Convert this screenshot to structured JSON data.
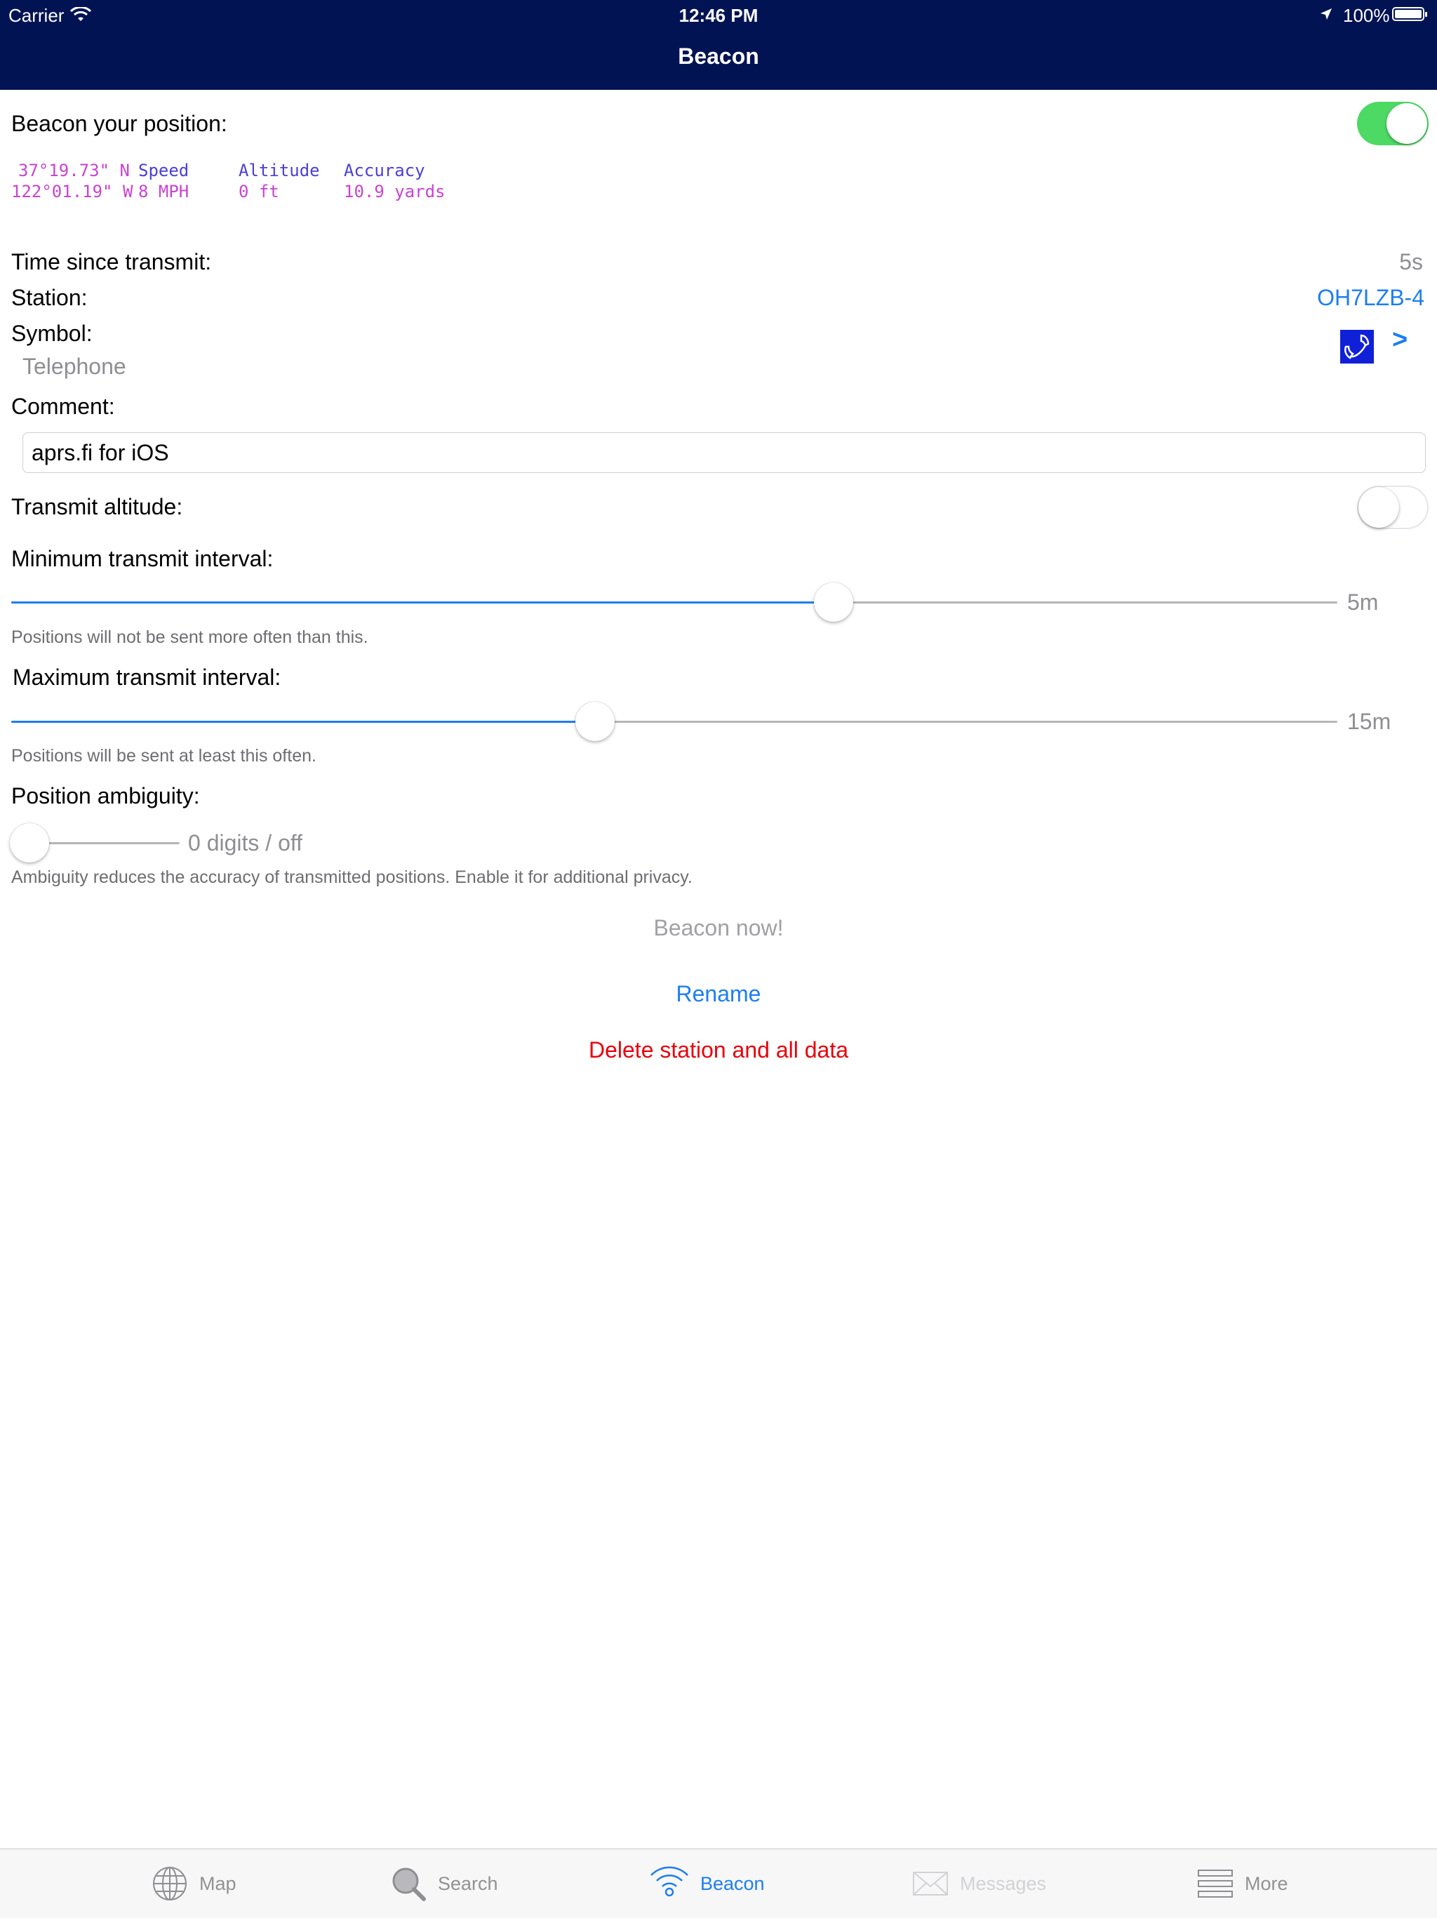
{
  "status_bar": {
    "carrier": "Carrier",
    "time": "12:46 PM",
    "battery": "100%"
  },
  "nav": {
    "title": "Beacon"
  },
  "beacon": {
    "label": "Beacon your position:",
    "enabled": true,
    "lat": "37°19.73\" N",
    "lon": "122°01.19\" W",
    "speed_label": "Speed",
    "speed_value": "8 MPH",
    "altitude_label": "Altitude",
    "altitude_value": "0 ft",
    "accuracy_label": "Accuracy",
    "accuracy_value": "10.9 yards"
  },
  "transmit": {
    "label": "Time since transmit:",
    "value": "5s"
  },
  "station": {
    "label": "Station:",
    "value": "OH7LZB-4"
  },
  "symbol": {
    "label": "Symbol:",
    "name": "Telephone",
    "icon": "telephone-icon",
    "chevron": ">"
  },
  "comment": {
    "label": "Comment:",
    "value": "aprs.fi for iOS"
  },
  "altitude_toggle": {
    "label": "Transmit altitude:",
    "enabled": false
  },
  "min_interval": {
    "label": "Minimum transmit interval:",
    "value": "5m",
    "level": 0.62,
    "footnote": "Positions will not be sent more often than this."
  },
  "max_interval": {
    "label": "Maximum transmit interval:",
    "value": "15m",
    "level": 0.44,
    "footnote": "Positions will be sent at least this often."
  },
  "ambiguity": {
    "label": "Position ambiguity:",
    "value": "0 digits / off",
    "level": 0,
    "footnote": "Ambiguity reduces the accuracy of transmitted positions. Enable it for additional privacy."
  },
  "actions": {
    "beacon_now": "Beacon now!",
    "rename": "Rename",
    "delete": "Delete station and all data"
  },
  "tabs": [
    {
      "label": "Map",
      "icon": "globe-icon"
    },
    {
      "label": "Search",
      "icon": "magnifier-icon"
    },
    {
      "label": "Beacon",
      "icon": "wifi-beacon-icon",
      "selected": true
    },
    {
      "label": "Messages",
      "icon": "envelope-icon",
      "disabled": true
    },
    {
      "label": "More",
      "icon": "list-icon"
    }
  ],
  "colors": {
    "nav_bg": "#021353",
    "tint": "#1e7ef0",
    "switch_on": "#4cd964",
    "destructive": "#e8000b",
    "mono_magenta": "#c844d0",
    "mono_blue": "#4b3fd6"
  }
}
